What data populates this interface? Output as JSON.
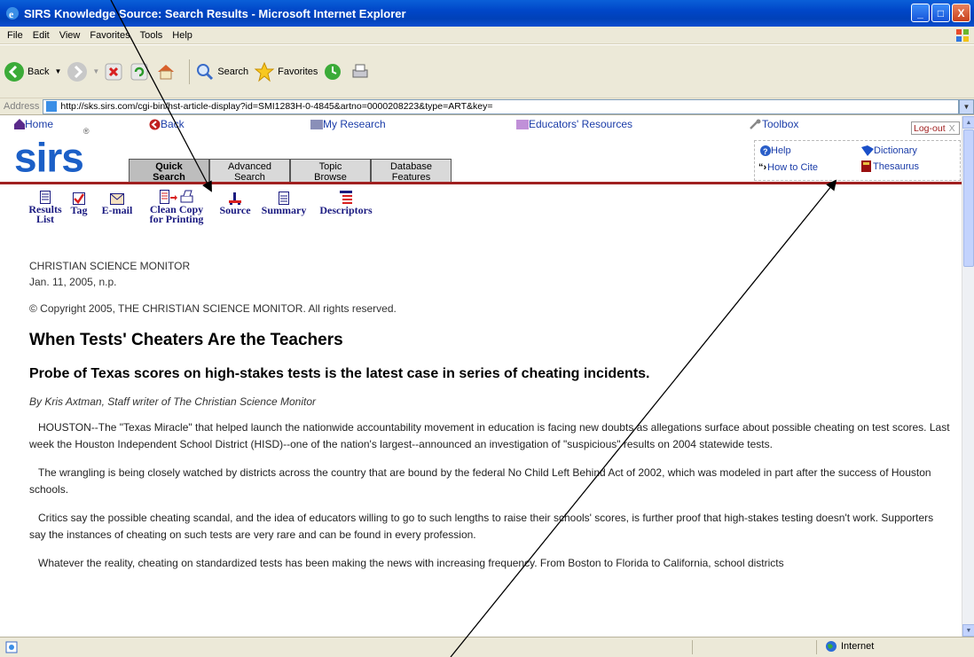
{
  "window": {
    "title": "SIRS Knowledge Source: Search Results - Microsoft Internet Explorer",
    "minimize": "_",
    "maximize": "□",
    "close": "X"
  },
  "menu": [
    "File",
    "Edit",
    "View",
    "Favorites",
    "Tools",
    "Help"
  ],
  "toolbar": {
    "back": "Back",
    "search": "Search",
    "favorites": "Favorites"
  },
  "address": {
    "label": "Address",
    "url": "http://sks.sirs.com/cgi-bin/hst-article-display?id=SMI1283H-0-4845&artno=0000208223&type=ART&key="
  },
  "sirs_nav": {
    "home": "Home",
    "back": "Back",
    "my_research": "My Research",
    "educators": "Educators' Resources",
    "toolbox": "Toolbox",
    "logout": "Log-out",
    "logout_x": "X"
  },
  "logo": {
    "text": "sirs",
    "reg": "®"
  },
  "tabs": [
    {
      "line1": "Quick",
      "line2": "Search"
    },
    {
      "line1": "Advanced",
      "line2": "Search"
    },
    {
      "line1": "Topic",
      "line2": "Browse"
    },
    {
      "line1": "Database",
      "line2": "Features"
    }
  ],
  "help_links": {
    "help": "Help",
    "dictionary": "Dictionary",
    "how_to_cite": "How to Cite",
    "thesaurus": "Thesaurus"
  },
  "actions": [
    {
      "line1": "Results",
      "line2": "List"
    },
    {
      "line1": "Tag",
      "line2": ""
    },
    {
      "line1": "E-mail",
      "line2": ""
    },
    {
      "line1": "Clean Copy",
      "line2": "for Printing"
    },
    {
      "line1": "Source",
      "line2": ""
    },
    {
      "line1": "Summary",
      "line2": ""
    },
    {
      "line1": "Descriptors",
      "line2": ""
    }
  ],
  "article": {
    "publication": "CHRISTIAN SCIENCE MONITOR",
    "date": "Jan. 11, 2005, n.p.",
    "copyright": "© Copyright 2005, THE CHRISTIAN SCIENCE MONITOR. All rights reserved.",
    "headline": "When Tests' Cheaters Are the Teachers",
    "subhead": "Probe of Texas scores on high-stakes tests is the latest case in series of cheating incidents.",
    "byline": "By Kris Axtman, Staff writer of The Christian Science Monitor",
    "paragraphs": [
      "HOUSTON--The \"Texas Miracle\" that helped launch the nationwide accountability movement in education is facing new doubts as allegations surface about possible cheating on test scores. Last week the Houston Independent School District (HISD)--one of the nation's largest--announced an investigation of \"suspicious\" results on 2004 statewide tests.",
      "The wrangling is being closely watched by districts across the country that are bound by the federal No Child Left Behind Act of 2002, which was modeled in part after the success of Houston schools.",
      "Critics say the possible cheating scandal, and the idea of educators willing to go to such lengths to raise their schools' scores, is further proof that high-stakes testing doesn't work. Supporters say the instances of cheating on such tests are very rare and can be found in every profession.",
      "Whatever the reality, cheating on standardized tests has been making the news with increasing frequency. From Boston to Florida to California, school districts"
    ]
  },
  "status": {
    "zone": "Internet"
  },
  "colors": {
    "title_bar": "#0046c8",
    "link": "#1a3ca8",
    "logo": "#1b5fc7",
    "chrome": "#ece9d8"
  }
}
